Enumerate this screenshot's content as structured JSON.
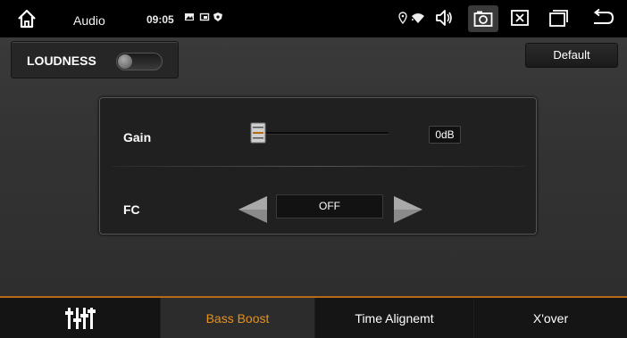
{
  "status_bar": {
    "title": "Audio",
    "time": "09:05",
    "icons": [
      "home-icon",
      "image-icon",
      "cast-icon",
      "shield-icon",
      "location-icon",
      "wifi-icon",
      "volume-icon",
      "screenshot-icon",
      "close-window-icon",
      "recent-apps-icon",
      "back-icon"
    ]
  },
  "loudness": {
    "label": "LOUDNESS",
    "enabled": false
  },
  "default_button": {
    "label": "Default"
  },
  "gain": {
    "label": "Gain",
    "value": "0dB",
    "level": 0
  },
  "fc": {
    "label": "FC",
    "value": "OFF"
  },
  "tabs": [
    {
      "label": "",
      "icon": "equalizer-icon",
      "active": false
    },
    {
      "label": "Bass Boost",
      "active": true
    },
    {
      "label": "Time Alignemt",
      "active": false
    },
    {
      "label": "X'over",
      "active": false
    }
  ],
  "colors": {
    "accent": "#e7921c",
    "divider_accent": "#b56a16",
    "background": "#333333"
  }
}
